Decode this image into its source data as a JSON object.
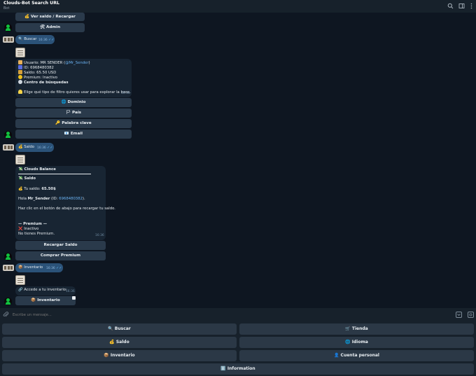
{
  "header": {
    "title": "Clouds-Bot Search URL",
    "subtitle": "Bot"
  },
  "top_buttons": {
    "saldo": "💰 Ver saldo / Recargar",
    "admin": "🛠 Admin"
  },
  "msg_buscar": {
    "text": "🔍 Buscar",
    "time": "16:36",
    "ticks": "✓✓"
  },
  "search_card": {
    "line1_prefix": "Usuario: MR SENDER (",
    "line1_handle": "@Mr_Sender",
    "line1_suffix": ")",
    "line2": "ID: 6968480382",
    "line3": "Saldo: 65.50 USD",
    "line4": "Premium: Inactivo",
    "line5": "Centro de búsquedas",
    "line6": "Elige qué tipo de filtro quieres usar para explorar la base.",
    "time": "16:36",
    "buttons": [
      "🌐 Dominio",
      "🏳 País",
      "🔑 Palabra clave",
      "📧 Email"
    ]
  },
  "msg_saldo": {
    "text": "💰 Saldo",
    "time": "16:36",
    "ticks": "✓✓"
  },
  "balance_card": {
    "heading": "💸 Clouds Balance",
    "saldo": "💸 Saldo",
    "tu_saldo_label": "💰 Tu saldo: ",
    "tu_saldo_value": "65.50$",
    "hola_prefix": "Hola ",
    "hola_name": "Mr_Sender",
    "hola_id_prefix": " (ID: ",
    "hola_id": "6968480382",
    "hola_suffix": ").",
    "instruction": "Haz clic en el botón de abajo para recargar tu saldo.",
    "premium_heading": "— Premium —",
    "inactivo": "❌ Inactivo",
    "no_premium": "No tienes Premium.",
    "time": "16:36",
    "buttons": [
      "Recargar Saldo",
      "Comprar Premium"
    ]
  },
  "msg_inventario": {
    "text": "📦 Inventario",
    "time": "16:36",
    "ticks": "✓✓"
  },
  "inventory_card": {
    "text": "🔗 Accede a tu inventario:",
    "time": "16:36",
    "button": "📦 Inventario"
  },
  "input": {
    "placeholder": "Escribe un mensaje..."
  },
  "reply_keyboard": {
    "buscar": "🔍 Buscar",
    "tienda": "🛒 Tienda",
    "saldo": "💰 Saldo",
    "idioma": "🌐 Idioma",
    "inventario": "📦 Inventario",
    "cuenta": "👤 Cuenta personal",
    "information": "ℹ️ Information"
  }
}
